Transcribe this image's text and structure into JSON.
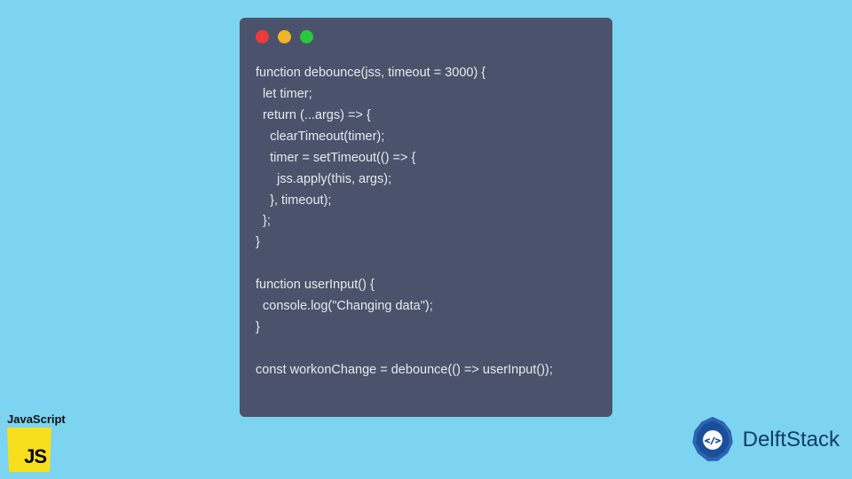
{
  "code_lines": [
    "function debounce(jss, timeout = 3000) {",
    "  let timer;",
    "  return (...args) => {",
    "    clearTimeout(timer);",
    "    timer = setTimeout(() => {",
    "      jss.apply(this, args);",
    "    }, timeout);",
    "  };",
    "}",
    "",
    "function userInput() {",
    "  console.log(\"Changing data\");",
    "}",
    "",
    "const workonChange = debounce(() => userInput());"
  ],
  "js_badge": {
    "title": "JavaScript",
    "logo_text": "JS"
  },
  "delftstack": {
    "label": "DelftStack"
  },
  "colors": {
    "page_bg": "#7cd4f0",
    "window_bg": "#4a536b",
    "code_fg": "#e8e9ee",
    "js_yellow": "#f7df1e",
    "delft_blue": "#133a6b"
  }
}
